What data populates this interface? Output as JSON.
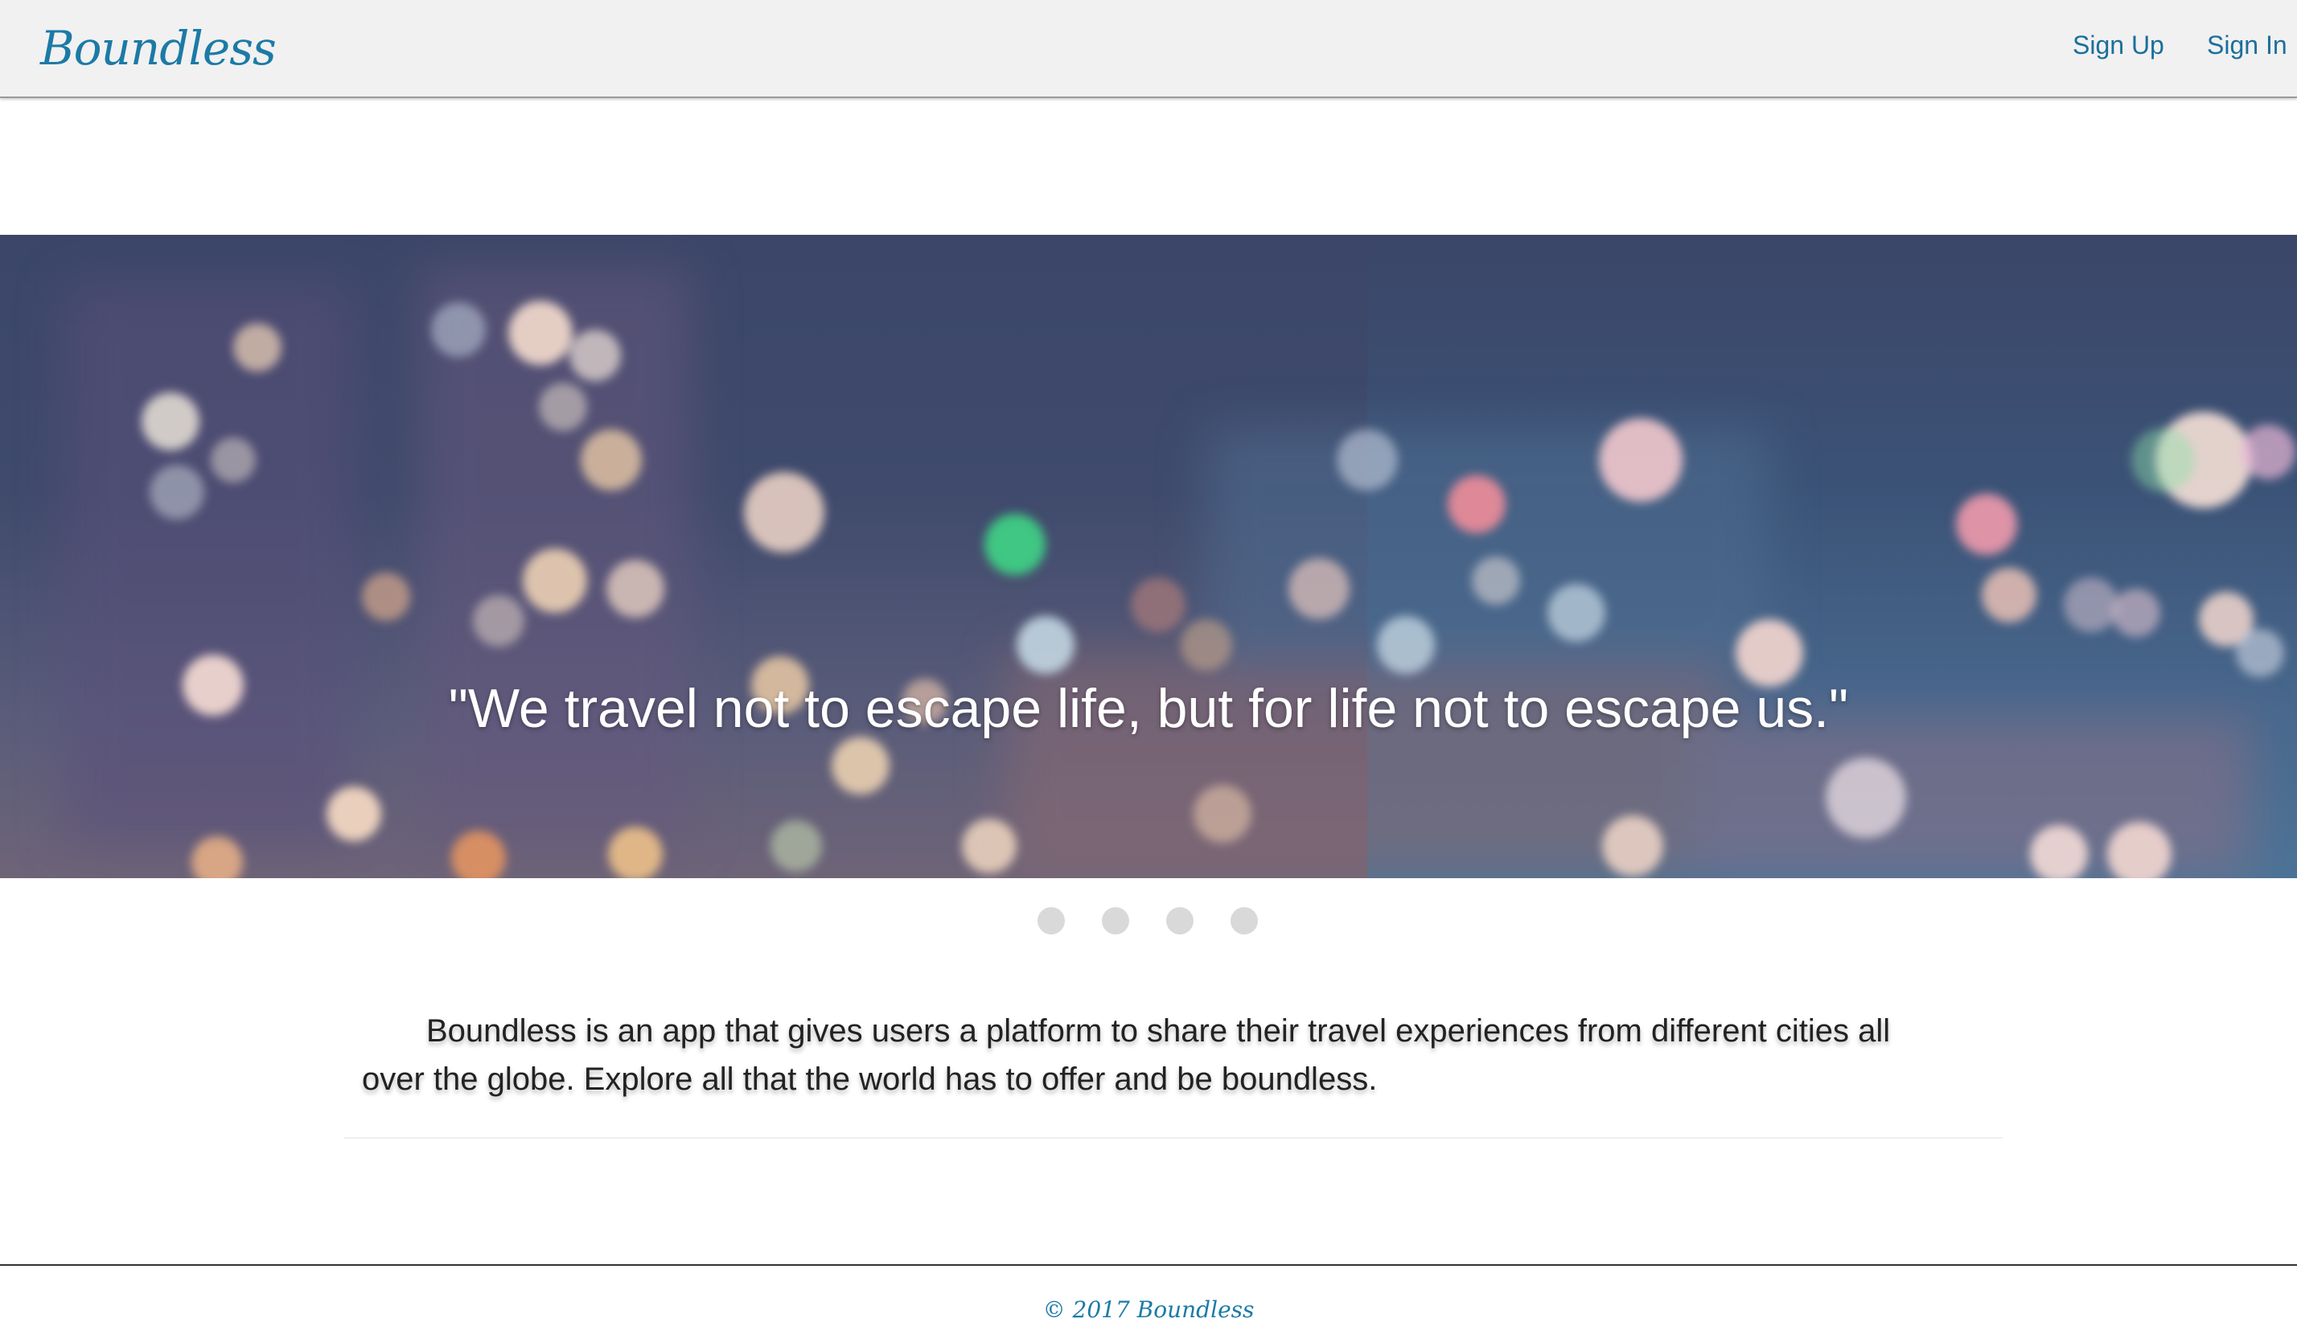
{
  "navbar": {
    "brand": "Boundless",
    "links": [
      {
        "label": "Sign Up"
      },
      {
        "label": "Sign In"
      }
    ]
  },
  "hero": {
    "quote": "\"We travel not to escape life, but for life not to escape us.\"",
    "slide_count": 4
  },
  "about": {
    "text": "Boundless is an app that gives users a platform to share their travel experiences from different cities all over the globe. Explore all that the world has to offer and be boundless."
  },
  "footer": {
    "text": "© 2017 Boundless"
  },
  "colors": {
    "brand": "#1c7aa6",
    "nav_background": "#f1f1f1",
    "indicator": "#d9d9d9"
  }
}
